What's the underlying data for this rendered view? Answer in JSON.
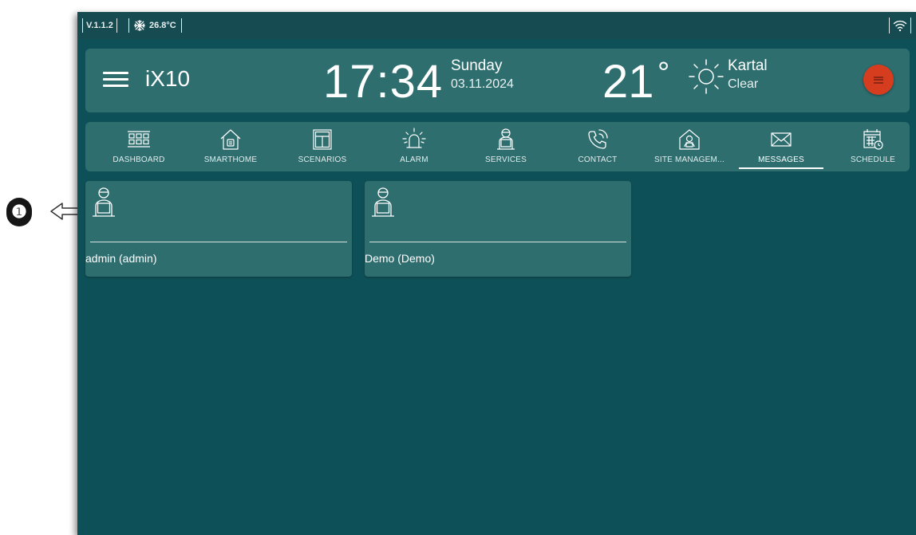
{
  "callout": {
    "number": "❶"
  },
  "statusbar": {
    "version": "V.1.1.2",
    "temperature": "26.8°C",
    "snowflake_icon": "snowflake-icon",
    "wifi_icon": "wifi-icon"
  },
  "header": {
    "app_name": "iX10",
    "time": "17:34",
    "day": "Sunday",
    "date": "03.11.2024",
    "weather_temp": "21",
    "weather_unit": "°",
    "weather_icon": "sun-icon",
    "city": "Kartal",
    "condition": "Clear"
  },
  "nav": {
    "items": [
      {
        "label": "DASHBOARD",
        "icon": "dashboard-grid-icon"
      },
      {
        "label": "SMARTHOME",
        "icon": "house-icon"
      },
      {
        "label": "SCENARIOS",
        "icon": "window-icon"
      },
      {
        "label": "ALARM",
        "icon": "siren-icon"
      },
      {
        "label": "SERVICES",
        "icon": "person-laptop-icon"
      },
      {
        "label": "CONTACT",
        "icon": "phone-icon"
      },
      {
        "label": "SITE MANAGEM...",
        "icon": "site-management-icon"
      },
      {
        "label": "MESSAGES",
        "icon": "envelope-icon"
      },
      {
        "label": "SCHEDULE",
        "icon": "calendar-clock-icon"
      }
    ],
    "active_index": 7
  },
  "users": [
    {
      "label": "admin (admin)",
      "icon": "person-laptop-icon"
    },
    {
      "label": "Demo (Demo)",
      "icon": "person-laptop-icon"
    }
  ],
  "colors": {
    "background": "#0e5057",
    "panel": "#2e6e6f",
    "statusbar": "#164b51",
    "accent": "#d63d1f"
  }
}
